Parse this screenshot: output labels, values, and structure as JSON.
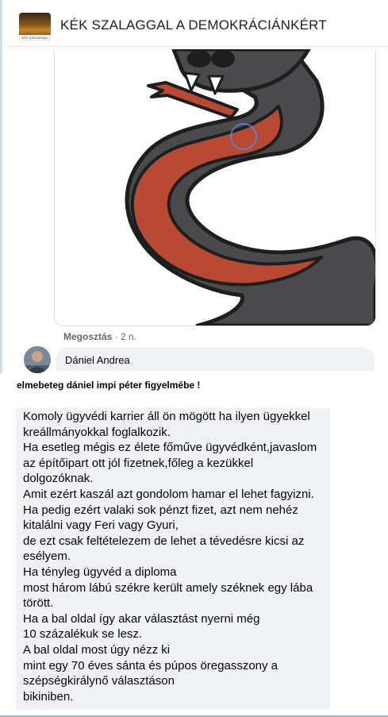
{
  "header": {
    "group_title": "KÉK SZALAGGAL A DEMOKRÁCIÁNKÉRT",
    "avatar_caption": "KÉK SZALAGGAL DEMOKR"
  },
  "post_image": {
    "subject": "snake-illustration",
    "colors": {
      "body": "#4a4a4c",
      "belly": "#b84a35",
      "outline": "#1e1e1e",
      "fangs": "#ffffff"
    }
  },
  "share": {
    "label": "Megosztás",
    "time": " · 2 n."
  },
  "comment": {
    "author": "Dániel Andrea"
  },
  "post": {
    "heading": "elmebeteg dániel impi péter figyelmébe !",
    "lines": [
      "Komoly ügyvédi karrier áll ön mögött ha ilyen ügyekkel",
      "kreállmányokkal foglalkozik.",
      "Ha esetleg mégis ez élete főműve ügyvédként,javaslom",
      "az építőipart ott jól fizetnek,főleg a kezükkel",
      "dolgozóknak.",
      "Amit ezért kaszál azt gondolom hamar el lehet fagyizni.",
      "Ha pedig ezért valaki sok pénzt fizet, azt nem nehéz",
      "kitalálni vagy Feri vagy Gyuri,",
      "de ezt csak feltételezem de lehet a tévedésre kicsi az",
      "esélyem.",
      "Ha tényleg ügyvéd a diploma",
      "most három lábú székre került amely széknek egy lába",
      "törött.",
      "Ha a bal oldal így akar választást nyerni még",
      "10 százalékuk se lesz.",
      "A bal oldal most úgy nézz ki",
      "mint egy 70 éves sánta és púpos öregasszony a",
      "szépségkirálynő választáson",
      "bikiniben."
    ]
  }
}
